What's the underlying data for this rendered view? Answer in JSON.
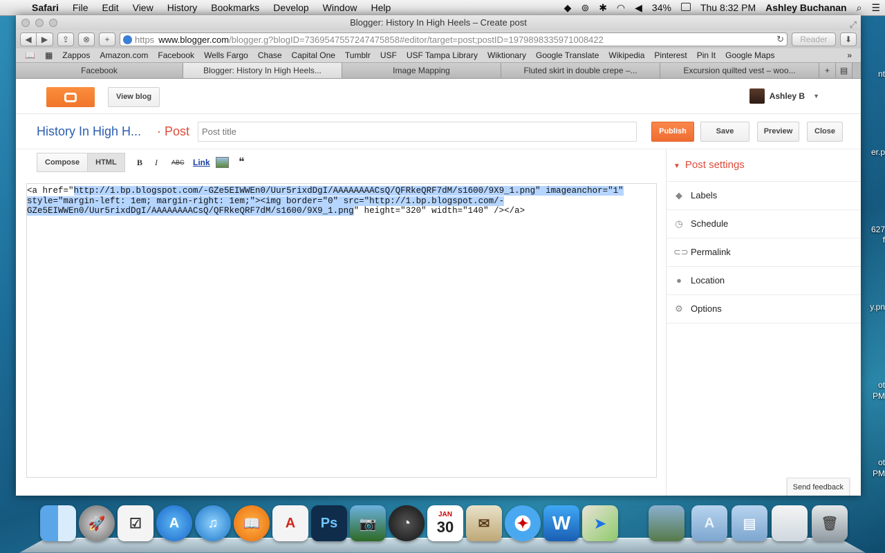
{
  "menubar": {
    "app": "Safari",
    "items": [
      "File",
      "Edit",
      "View",
      "History",
      "Bookmarks",
      "Develop",
      "Window",
      "Help"
    ],
    "battery": "34%",
    "clock": "Thu 8:32 PM",
    "user": "Ashley Buchanan"
  },
  "window": {
    "title": "Blogger: History In High Heels – Create post"
  },
  "toolbar": {
    "url_scheme": "https",
    "url_domain": "www.blogger.com",
    "url_path": "/blogger.g?blogID=7369547557247475858#editor/target=post;postID=1979898335971008422",
    "reader": "Reader"
  },
  "bookmarks": [
    "Zappos",
    "Amazon.com",
    "Facebook",
    "Wells Fargo",
    "Chase",
    "Capital One",
    "Tumblr",
    "USF",
    "USF Tampa Library",
    "Wiktionary",
    "Google Translate",
    "Wikipedia",
    "Pinterest",
    "Pin It",
    "Google Maps"
  ],
  "tabs": [
    "Facebook",
    "Blogger: History In High Heels...",
    "Image Mapping",
    "Fluted skirt in double crepe –...",
    "Excursion quilted vest – woo..."
  ],
  "blogger": {
    "view_blog": "View blog",
    "user_name": "Ashley B",
    "blog_name": "History In High H...",
    "post_label": "· Post",
    "post_title_placeholder": "Post title",
    "publish": "Publish",
    "save": "Save",
    "preview": "Preview",
    "close": "Close",
    "compose": "Compose",
    "html": "HTML",
    "bold": "B",
    "italic": "I",
    "strike": "ABC",
    "link": "Link",
    "quote": "❝",
    "editor_pre": "<a href=\"",
    "editor_sel1": "http://1.bp.blogspot.com/-GZe5EIWWEn0/Uur5rixdDgI/AAAAAAAACsQ/QFRkeQRF7dM/s1600/9X9_1.png\" imageanchor=\"1\"",
    "editor_sel2": "style=\"margin-left: 1em; margin-right: 1em;\"><img border=\"0\" src=\"http://1.bp.blogspot.com/-",
    "editor_sel3": "GZe5EIWWEn0/Uur5rixdDgI/AAAAAAAACsQ/QFRkeQRF7dM/s1600/9X9_1.png",
    "editor_post": "\" height=\"320\" width=\"140\" /></a>",
    "post_settings": "Post settings",
    "settings": [
      "Labels",
      "Schedule",
      "Permalink",
      "Location",
      "Options"
    ],
    "feedback": "Send feedback"
  },
  "desktop_edge_text": [
    "er.p",
    "627",
    "f",
    "y.pn",
    "ot",
    "PM",
    "ot",
    "PM",
    "nt"
  ],
  "dock": {
    "calendar_month": "JAN",
    "calendar_day": "30"
  }
}
